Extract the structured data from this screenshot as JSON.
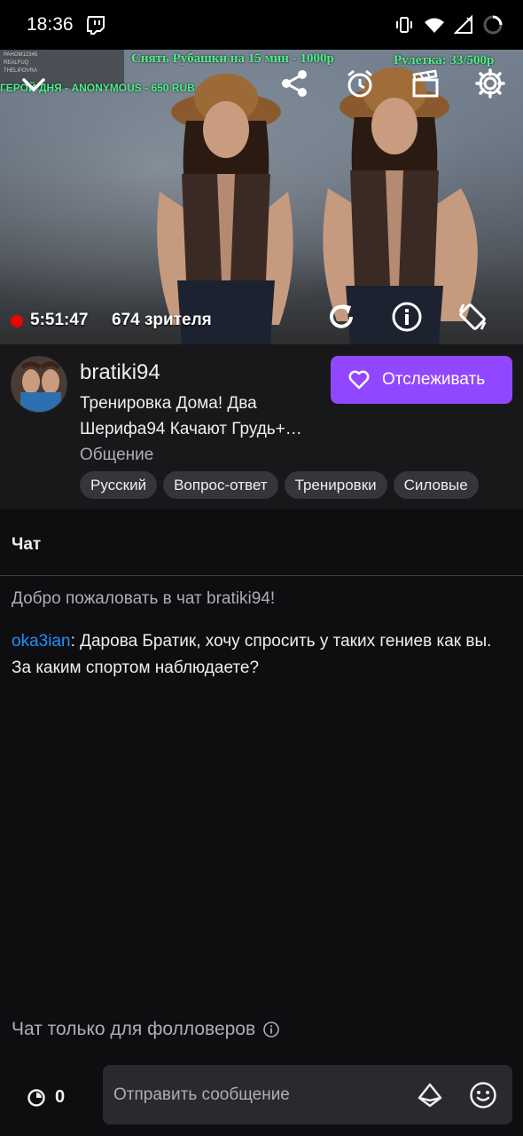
{
  "status_bar": {
    "time": "18:36"
  },
  "video": {
    "overlay_top": "Снять Рубашки на 15 мин - 1000р",
    "overlay_right": "Рулетка: 33/500р",
    "overlay_hero": "ГЕРОЙ ДНЯ - ANONYMOUS - 650 RUB",
    "overlay_list": [
      "PAHOM12345",
      "REALFUQ",
      "THELIPOVRA"
    ],
    "uptime": "5:51:47",
    "viewers": "674 зрителя"
  },
  "channel": {
    "name": "bratiki94",
    "title": "Тренировка Дома! Два Шерифа94 Качают Грудь+…",
    "category": "Общение",
    "follow_label": "Отслеживать",
    "tags": [
      "Русский",
      "Вопрос-ответ",
      "Тренировки",
      "Силовые"
    ]
  },
  "chat": {
    "header": "Чат",
    "welcome": "Добро пожаловать в чат bratiki94!",
    "messages": [
      {
        "user": "oka3ian",
        "text": "Дарова Братик, хочу спросить у таких гениев как вы. За каким спортом наблюдаете?"
      }
    ],
    "followers_only": "Чат только для фолловеров",
    "points": "0",
    "input_placeholder": "Отправить сообщение"
  },
  "colors": {
    "accent": "#9147ff",
    "username": "#1e90ff",
    "live": "#eb0400",
    "overlay_green": "#4ef08a"
  }
}
